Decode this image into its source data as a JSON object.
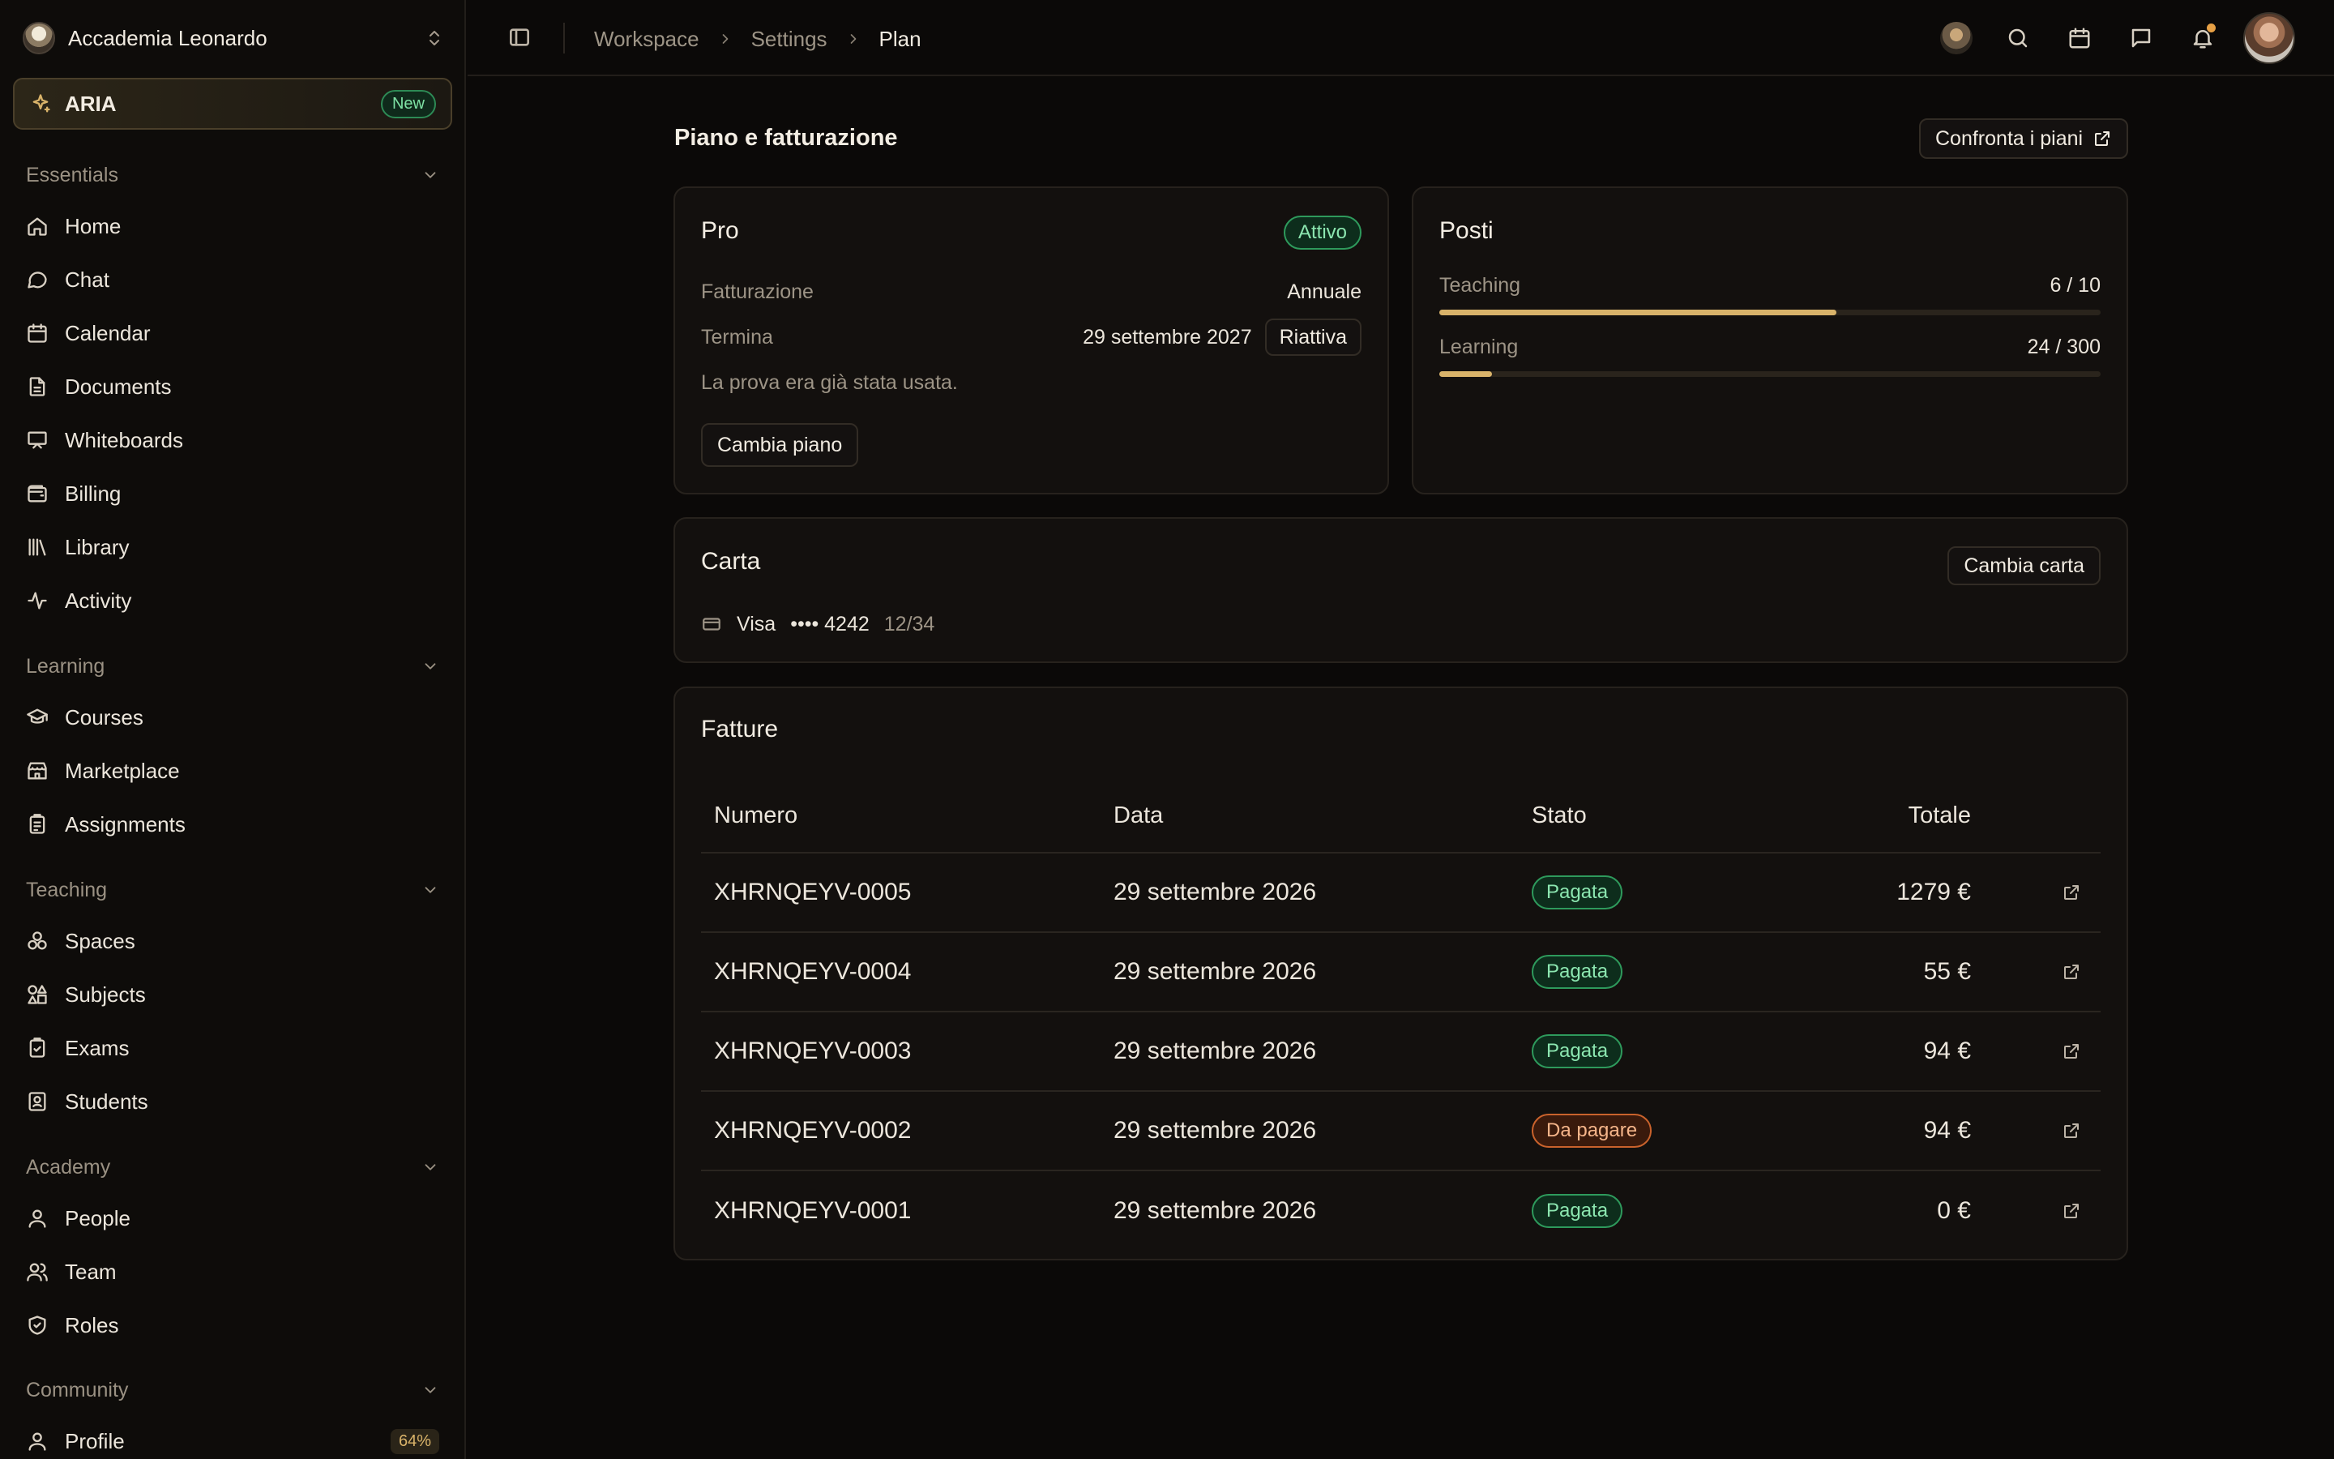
{
  "workspace": {
    "name": "Accademia Leonardo"
  },
  "aria": {
    "label": "ARIA",
    "badge": "New"
  },
  "sidebar": {
    "sections": [
      {
        "title": "Essentials",
        "items": [
          {
            "label": "Home",
            "icon": "home-icon"
          },
          {
            "label": "Chat",
            "icon": "chat-icon"
          },
          {
            "label": "Calendar",
            "icon": "calendar-icon"
          },
          {
            "label": "Documents",
            "icon": "document-icon"
          },
          {
            "label": "Whiteboards",
            "icon": "whiteboard-icon"
          },
          {
            "label": "Billing",
            "icon": "wallet-icon"
          },
          {
            "label": "Library",
            "icon": "library-icon"
          },
          {
            "label": "Activity",
            "icon": "activity-icon"
          }
        ]
      },
      {
        "title": "Learning",
        "items": [
          {
            "label": "Courses",
            "icon": "graduation-cap-icon"
          },
          {
            "label": "Marketplace",
            "icon": "store-icon"
          },
          {
            "label": "Assignments",
            "icon": "clipboard-icon"
          }
        ]
      },
      {
        "title": "Teaching",
        "items": [
          {
            "label": "Spaces",
            "icon": "spaces-icon"
          },
          {
            "label": "Subjects",
            "icon": "shapes-icon"
          },
          {
            "label": "Exams",
            "icon": "clipboard-check-icon"
          },
          {
            "label": "Students",
            "icon": "id-badge-icon"
          }
        ]
      },
      {
        "title": "Academy",
        "items": [
          {
            "label": "People",
            "icon": "user-icon"
          },
          {
            "label": "Team",
            "icon": "users-icon"
          },
          {
            "label": "Roles",
            "icon": "shield-icon"
          }
        ]
      },
      {
        "title": "Community",
        "items": [
          {
            "label": "Profile",
            "icon": "user-icon",
            "badge": "64%"
          }
        ]
      }
    ]
  },
  "breadcrumb": [
    "Workspace",
    "Settings",
    "Plan"
  ],
  "page": {
    "title": "Piano e fatturazione",
    "compare_label": "Confronta i piani"
  },
  "plan": {
    "name": "Pro",
    "status": "Attivo",
    "billing_label": "Fatturazione",
    "billing_value": "Annuale",
    "end_label": "Termina",
    "end_value": "29 settembre 2027",
    "reactivate_label": "Riattiva",
    "trial_note": "La prova era già stata usata.",
    "change_label": "Cambia piano"
  },
  "seats": {
    "title": "Posti",
    "items": [
      {
        "label": "Teaching",
        "used": 6,
        "total": 10,
        "value": "6 / 10"
      },
      {
        "label": "Learning",
        "used": 24,
        "total": 300,
        "value": "24 / 300"
      }
    ]
  },
  "card": {
    "title": "Carta",
    "change_label": "Cambia carta",
    "brand": "Visa",
    "number": "•••• 4242",
    "expiry": "12/34"
  },
  "invoices": {
    "title": "Fatture",
    "columns": {
      "number": "Numero",
      "date": "Data",
      "status": "Stato",
      "total": "Totale"
    },
    "rows": [
      {
        "number": "XHRNQEYV-0005",
        "date": "29 settembre 2026",
        "status": "Pagata",
        "paid": true,
        "total": "1279 €"
      },
      {
        "number": "XHRNQEYV-0004",
        "date": "29 settembre 2026",
        "status": "Pagata",
        "paid": true,
        "total": "55 €"
      },
      {
        "number": "XHRNQEYV-0003",
        "date": "29 settembre 2026",
        "status": "Pagata",
        "paid": true,
        "total": "94 €"
      },
      {
        "number": "XHRNQEYV-0002",
        "date": "29 settembre 2026",
        "status": "Da pagare",
        "paid": false,
        "total": "94 €"
      },
      {
        "number": "XHRNQEYV-0001",
        "date": "29 settembre 2026",
        "status": "Pagata",
        "paid": true,
        "total": "0 €"
      }
    ]
  },
  "colors": {
    "background": "#0b0908",
    "accent": "#d9b36a",
    "paid": "#2e9a5c",
    "due": "#c9622c"
  }
}
